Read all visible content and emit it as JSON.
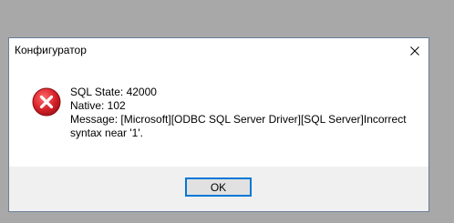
{
  "dialog": {
    "title": "Конфигуратор",
    "close_icon": "close-icon",
    "error_icon": "error-icon",
    "error_color": "#e81123",
    "message_lines": [
      "SQL State: 42000",
      "Native: 102",
      "Message: [Microsoft][ODBC SQL Server Driver][SQL Server]Incorrect",
      "syntax near '1'."
    ],
    "ok_label": "OK",
    "accent": "#0078d7"
  }
}
